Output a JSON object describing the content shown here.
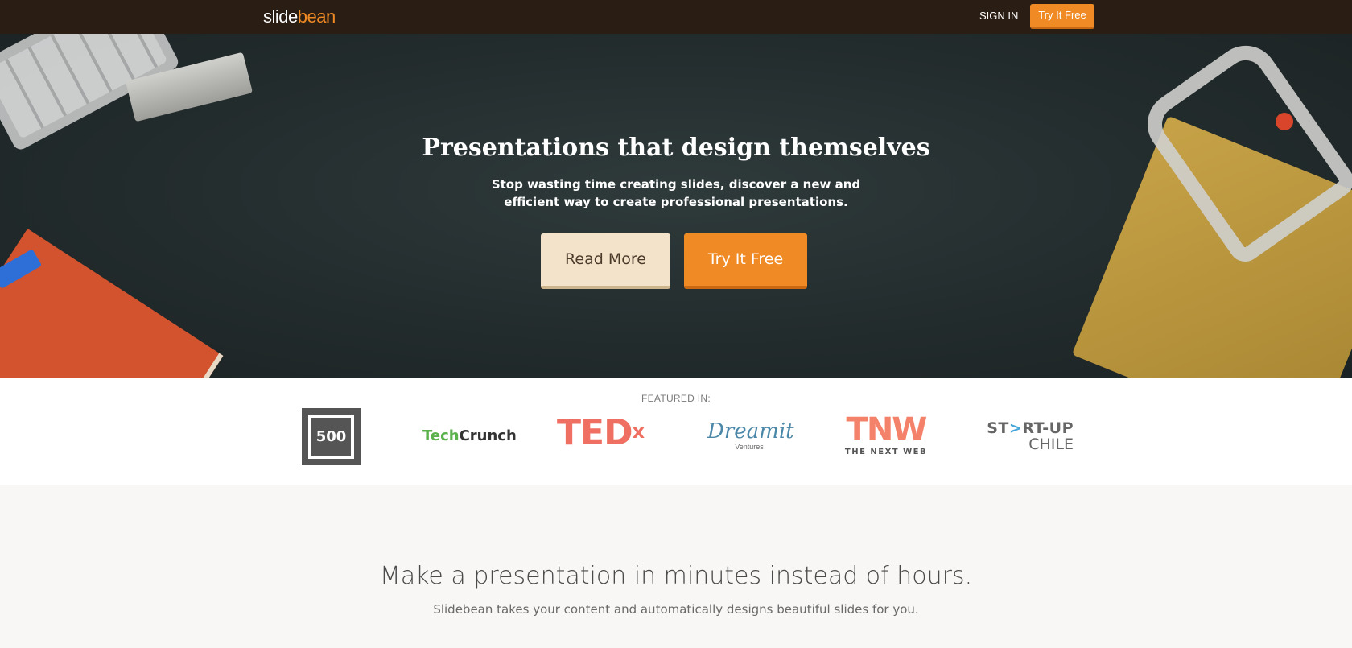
{
  "nav": {
    "logo_primary": "slide",
    "logo_accent": "bean",
    "signin_label": "SIGN IN",
    "cta_label": "Try It Free"
  },
  "hero": {
    "title": "Presentations that design themselves",
    "subtitle": "Stop wasting time creating slides, discover a new and efficient way to create professional presentations.",
    "read_more_label": "Read More",
    "try_label": "Try It Free"
  },
  "featured": {
    "label": "FEATURED IN:",
    "logos": {
      "l500": "500",
      "techcrunch_a": "Tech",
      "techcrunch_b": "Crunch",
      "tedx_a": "TED",
      "tedx_b": "x",
      "dreamit_a": "Dreamit",
      "dreamit_b": "Ventures",
      "tnw_a": "TNW",
      "tnw_b": "THE NEXT WEB",
      "startup_a1": "ST",
      "startup_arrow": ">",
      "startup_a2": "RT-UP",
      "startup_b": "CHILE"
    }
  },
  "section": {
    "title": "Make a presentation in minutes instead of hours.",
    "subtitle": "Slidebean takes your content and automatically designs beautiful slides for you."
  },
  "colors": {
    "nav_bg": "#2a1d14",
    "accent_orange": "#f08a24",
    "read_more_bg": "#f3e3ca",
    "page_bg": "#f8f7f5"
  }
}
